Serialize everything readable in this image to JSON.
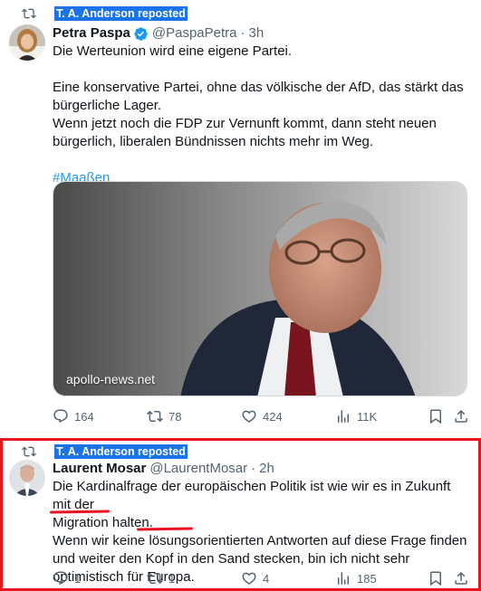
{
  "tweets": [
    {
      "repost_label": "T. A. Anderson reposted",
      "name": "Petra Paspa",
      "handle": "@PaspaPetra",
      "separator": "·",
      "time": "3h",
      "body_lines": [
        "Die Werteunion wird eine eigene Partei.",
        "Eine konservative Partei, ohne das völkische der AfD, das stärkt das bürgerliche Lager.",
        "Wenn jetzt noch die FDP zur Vernunft kommt, dann steht neuen bürgerlich, liberalen Bündnissen nichts mehr im Weg."
      ],
      "hashtag": "#Maaßen",
      "media_caption": "apollo-news.net",
      "stats": {
        "replies": "164",
        "reposts": "78",
        "likes": "424",
        "views": "11K"
      }
    },
    {
      "repost_label": "T. A. Anderson reposted",
      "name": "Laurent Mosar",
      "handle": "@LaurentMosar",
      "separator": "·",
      "time": "2h",
      "body_line1": "Die Kardinalfrage der europäischen Politik ist wie wir es in Zukunft mit der",
      "body_migration": "Migration",
      "body_line2_rest": " halten.",
      "body_line3_a": "Wenn wir keine ",
      "body_loesungs": "lösungs",
      "body_line3_b": "orientierten Antworten auf diese Frage finden und weiter den Kopf in den Sand stecken, bin ich nicht sehr optimistisch für Europa.",
      "stats": {
        "replies": "1",
        "reposts": "1",
        "likes": "4",
        "views": "185"
      }
    }
  ],
  "colors": {
    "accent": "#1d9bf0",
    "highlight": "#e8141f",
    "repost_label_bg": "#1a73e8"
  },
  "icons": [
    "repost-icon",
    "verified-badge-icon",
    "reply-icon",
    "like-icon",
    "views-icon",
    "bookmark-icon",
    "share-icon"
  ]
}
